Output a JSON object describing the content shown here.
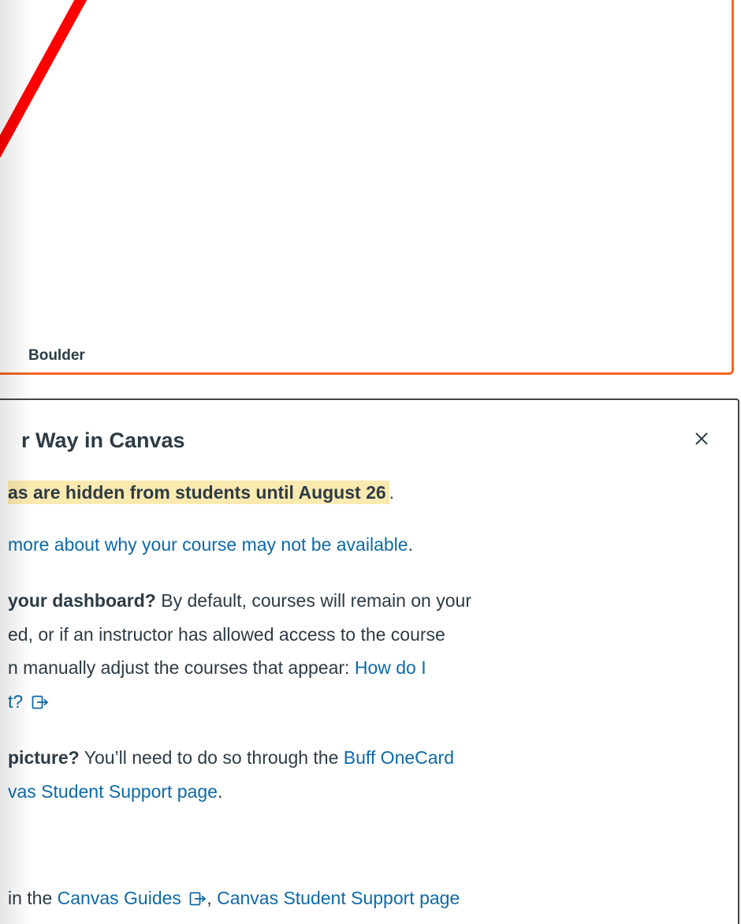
{
  "course_card": {
    "footer_text": "Boulder"
  },
  "notice": {
    "title": "r Way in Canvas",
    "close_icon": "close-icon",
    "hidden_courses_text": "as are hidden from students until August 26",
    "period": ".",
    "learn_more_link": "more about why your course may not be available",
    "dashboard_bold": "your dashboard?",
    "dashboard_line1_rest": " By default, courses will remain on your",
    "dashboard_line2": "ed, or if an instructor has allowed access to the course",
    "dashboard_line3_text": "n manually adjust the courses that appear: ",
    "dashboard_line3_link": "How do I",
    "dashboard_line4_link": "t?",
    "picture_bold": "picture?",
    "picture_rest": " You’ll need to do so through the ",
    "picture_link1": "Buff OneCard",
    "picture_line2_link": "vas Student Support page",
    "guides_prefix": "in the ",
    "guides_link": "Canvas Guides",
    "guides_comma": ", ",
    "support_link": "Canvas Student Support page"
  },
  "colors": {
    "card_border": "#f26722",
    "highlight": "#fbeab0",
    "link": "#0e6aa6",
    "annotation_red": "#ff0000"
  }
}
